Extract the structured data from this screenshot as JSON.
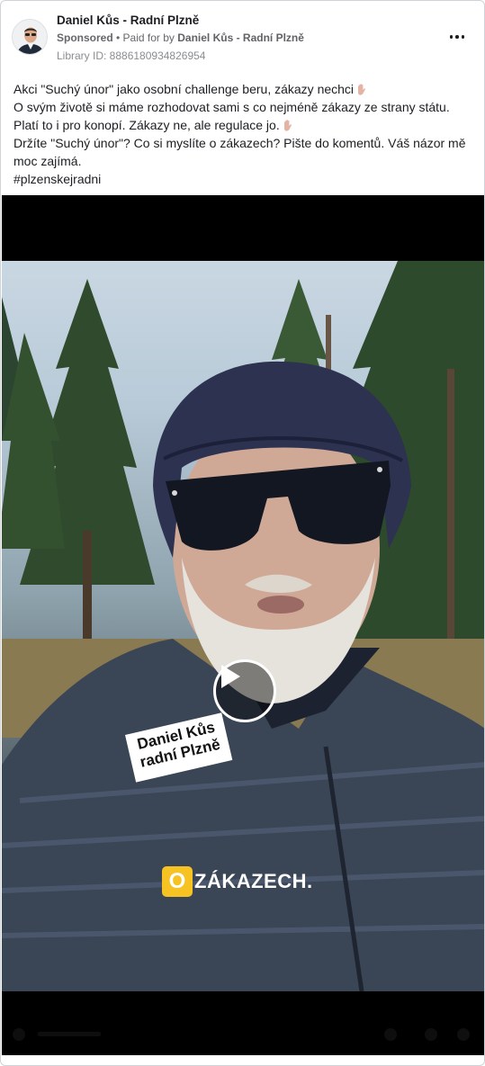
{
  "ad": {
    "page_name": "Daniel Kůs - Radní Plzně",
    "sponsored_label": "Sponsored",
    "separator": " • ",
    "paid_for_prefix": "Paid for by ",
    "payer_name": "Daniel Kůs - Radní Plzně",
    "library_id": "Library ID: 8886180934826954"
  },
  "post": {
    "line1": "Akci \"Suchý únor\" jako osobní challenge beru, zákazy nechci",
    "line2": "O svým životě si máme rozhodovat sami s co nejméně zákazy ze strany státu.",
    "line3": "Platí to i pro konopí. Zákazy ne, ale regulace jo.",
    "line4": "Držíte \"Suchý únor\"? Co si myslíte o zákazech? Pište do komentů. Váš názor mě moc zajímá.",
    "line5": "#plzenskejradni"
  },
  "video": {
    "name_tag_line1": "Daniel Kůs",
    "name_tag_line2": "radní Plzně",
    "brand_letter": "O",
    "brand_word": "ZÁKAZECH."
  },
  "icons": {
    "more": "more-options-icon",
    "play": "play-icon",
    "hand": "raised-hand-emoji"
  },
  "colors": {
    "brand_yellow": "#f6c323",
    "text": "#1c1e21",
    "muted": "#65676b"
  }
}
